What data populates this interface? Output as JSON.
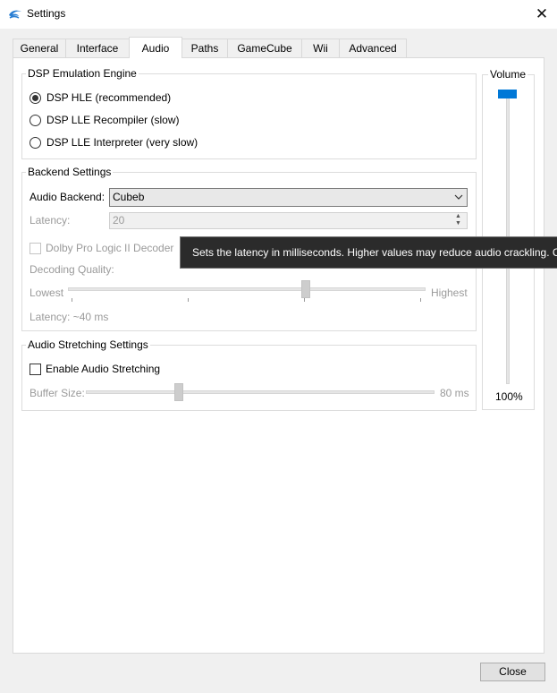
{
  "window": {
    "title": "Settings",
    "icon": "dolphin-icon",
    "close_glyph": "✕"
  },
  "tabs": [
    {
      "label": "General"
    },
    {
      "label": "Interface"
    },
    {
      "label": "Audio",
      "selected": true
    },
    {
      "label": "Paths"
    },
    {
      "label": "GameCube"
    },
    {
      "label": "Wii"
    },
    {
      "label": "Advanced"
    }
  ],
  "dsp": {
    "title": "DSP Emulation Engine",
    "options": [
      {
        "label": "DSP HLE (recommended)",
        "selected": true
      },
      {
        "label": "DSP LLE Recompiler (slow)",
        "selected": false
      },
      {
        "label": "DSP LLE Interpreter (very slow)",
        "selected": false
      }
    ]
  },
  "backend": {
    "title": "Backend Settings",
    "audio_backend_label": "Audio Backend:",
    "audio_backend_value": "Cubeb",
    "latency_label": "Latency:",
    "latency_value": "20",
    "dolby_label": "Dolby Pro Logic II Decoder",
    "dolby_checked": false,
    "decoding_quality_label": "Decoding Quality:",
    "quality_lowest": "Lowest",
    "quality_highest": "Highest",
    "quality_level": 0.67,
    "latency_readout": "Latency: ~40 ms"
  },
  "tooltip": {
    "text": "Sets the latency in milliseconds. Higher values may reduce audio crackling. Ce"
  },
  "stretching": {
    "title": "Audio Stretching Settings",
    "enable_label": "Enable Audio Stretching",
    "enable_checked": false,
    "buffer_label": "Buffer Size:",
    "buffer_value": "80 ms",
    "buffer_level": 0.26
  },
  "volume": {
    "title": "Volume",
    "value": "100%",
    "level": 1.0
  },
  "footer": {
    "close_label": "Close"
  },
  "colors": {
    "accent": "#0078d7",
    "tooltip_bg": "#2b2b2b",
    "pane_bg": "#ffffff",
    "window_bg": "#f0f0f0"
  }
}
